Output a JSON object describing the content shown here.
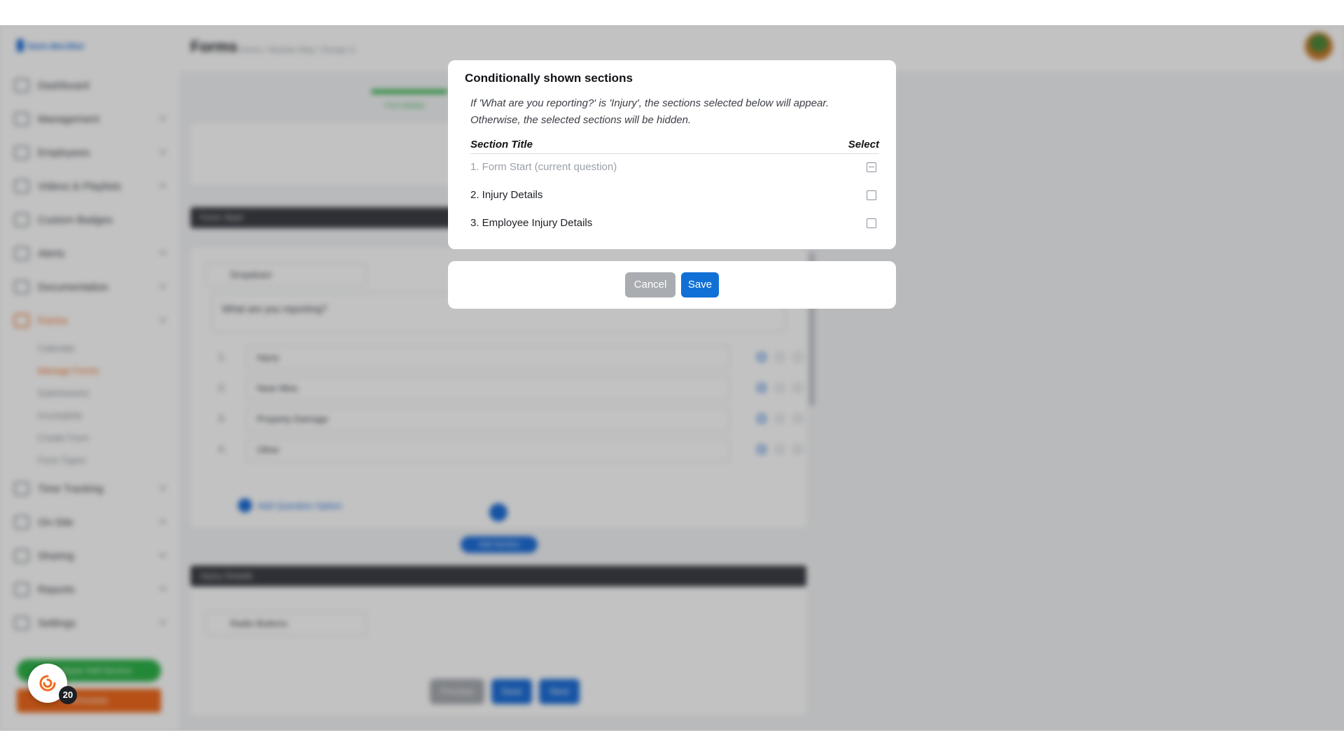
{
  "background": {
    "brand": "kore.dev.blur",
    "header": {
      "title": "Forms",
      "crumbs": "Home  /  Module Map  /  Design it"
    },
    "nav": [
      {
        "label": "Dashboard"
      },
      {
        "label": "Management"
      },
      {
        "label": "Employees"
      },
      {
        "label": "Videos & Playlists"
      },
      {
        "label": "Custom Badges"
      },
      {
        "label": "Alerts"
      },
      {
        "label": "Documentation"
      },
      {
        "label": "Forms"
      },
      {
        "label": "Time Tracking"
      },
      {
        "label": "On-Site"
      },
      {
        "label": "Sharing"
      },
      {
        "label": "Reports"
      },
      {
        "label": "Settings"
      }
    ],
    "forms_sub": [
      "Calendar",
      "Manage Forms",
      "Submissions",
      "Incomplete",
      "Create Form",
      "Form Types"
    ],
    "side_green": "Employee Self-Service",
    "side_orange": "Schedule",
    "progress_label": "Form Builder",
    "section1_bar": "Form Start",
    "section2_bar": "Injury Details",
    "select_type": "Dropdown",
    "select_type2": "Radio Buttons",
    "question": "What are you reporting?",
    "options": [
      "Injury",
      "Near Miss",
      "Property Damage",
      "Other"
    ],
    "add_option": "Add Question Option",
    "pill": "Add Section",
    "bottom_buttons": [
      "Preview",
      "Save",
      "Next"
    ]
  },
  "floating_badge": {
    "count": "20"
  },
  "modal": {
    "title": "Conditionally shown sections",
    "description_line1": "If 'What are you reporting?' is 'Injury', the sections selected below will appear.",
    "description_line2": "Otherwise, the selected sections will be hidden.",
    "columns": {
      "title": "Section Title",
      "select": "Select"
    },
    "rows": [
      {
        "label": "1. Form Start (current question)",
        "disabled": true,
        "state": "indeterminate"
      },
      {
        "label": "2. Injury Details",
        "disabled": false,
        "state": "unchecked"
      },
      {
        "label": "3. Employee Injury Details",
        "disabled": false,
        "state": "unchecked"
      }
    ],
    "cancel_label": "Cancel",
    "save_label": "Save"
  }
}
